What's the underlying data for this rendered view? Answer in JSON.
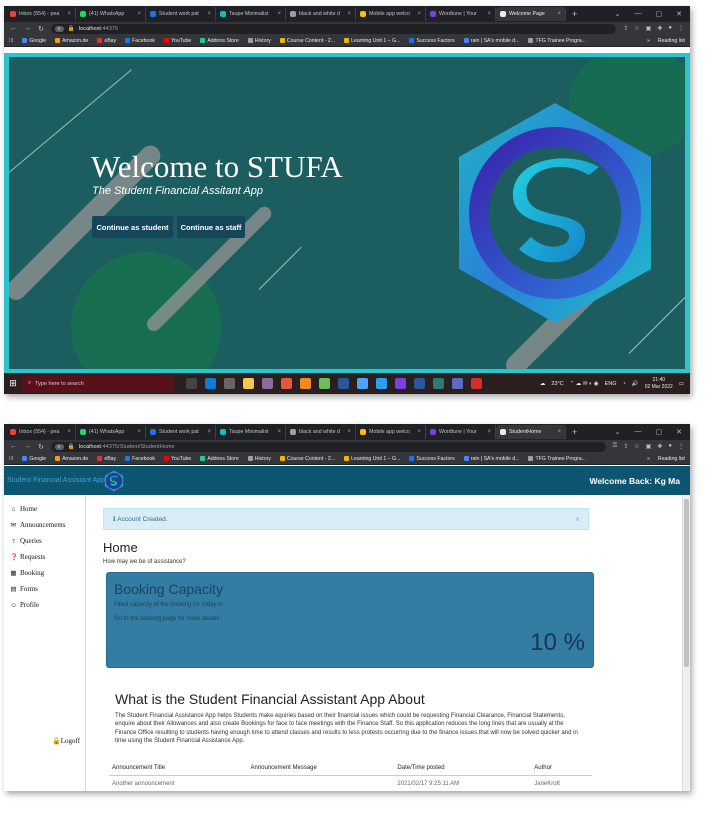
{
  "browser1": {
    "tabs": [
      {
        "label": "Inbox (554) - pea",
        "color": "#ea4335"
      },
      {
        "label": "(41) WhatsApp",
        "color": "#25d366"
      },
      {
        "label": "Student work pat",
        "color": "#1a73e8"
      },
      {
        "label": "Taupe Minimalist",
        "color": "#00c4cc"
      },
      {
        "label": "black and white d",
        "color": "#9aa0a6"
      },
      {
        "label": "Mobile app welco",
        "color": "#fbbc04"
      },
      {
        "label": "Wordtune | Your",
        "color": "#7b3fe4"
      },
      {
        "label": "Welcome Page",
        "color": "#e8eaed"
      }
    ],
    "active_tab": 7,
    "url_host": "localhost",
    "url_path": ":44375"
  },
  "browser2": {
    "tabs": [
      {
        "label": "Inbox (554) - pea",
        "color": "#ea4335"
      },
      {
        "label": "(41) WhatsApp",
        "color": "#25d366"
      },
      {
        "label": "Student work pat",
        "color": "#1a73e8"
      },
      {
        "label": "Taupe Minimalist",
        "color": "#00c4cc"
      },
      {
        "label": "black and white d",
        "color": "#9aa0a6"
      },
      {
        "label": "Mobile app welco",
        "color": "#fbbc04"
      },
      {
        "label": "Wordtune | Your",
        "color": "#7b3fe4"
      },
      {
        "label": "StudentHome",
        "color": "#e8eaed"
      }
    ],
    "active_tab": 7,
    "url_host": "localhost",
    "url_path": ":44375/Student/StudentHome"
  },
  "bookmarks": [
    {
      "label": "Google",
      "color": "#4285f4"
    },
    {
      "label": "Amazon.de",
      "color": "#ff9900"
    },
    {
      "label": "eBay",
      "color": "#e53238"
    },
    {
      "label": "Facebook",
      "color": "#1877f2"
    },
    {
      "label": "YouTube",
      "color": "#ff0000"
    },
    {
      "label": "Addons Store",
      "color": "#20c997"
    },
    {
      "label": "History",
      "color": "#9aa0a6"
    },
    {
      "label": "Course Content - 2...",
      "color": "#f4b400"
    },
    {
      "label": "Learning Unit 1 – G...",
      "color": "#f4b400"
    },
    {
      "label": "Success Factors",
      "color": "#1a73e8"
    },
    {
      "label": "rain | SA's mobile d...",
      "color": "#4285f4"
    },
    {
      "label": "TFG Trainee Progra...",
      "color": "#9aa0a6"
    }
  ],
  "reading_list": "Reading list",
  "welcome": {
    "title": "Welcome to STUFA",
    "subtitle": "The Student Financial Assitant App",
    "btn_student": "Continue as student",
    "btn_staff": "Continue as staff"
  },
  "taskbar": {
    "search_placeholder": "Type here to search",
    "weather": "23°C",
    "lang": "ENG",
    "time": "21:40",
    "date": "02 Mar 2022"
  },
  "app": {
    "brand": "Student Financial Assistant App",
    "welcome_back": "Welcome Back: Kg Ma",
    "nav": [
      {
        "label": "Home",
        "icon": "home-icon",
        "glyph": "⌂"
      },
      {
        "label": "Announcements",
        "icon": "bullhorn-icon",
        "glyph": "✉"
      },
      {
        "label": "Queries",
        "icon": "question-icon",
        "glyph": "?"
      },
      {
        "label": "Requests",
        "icon": "question-circle-icon",
        "glyph": "❓"
      },
      {
        "label": "Booking",
        "icon": "calendar-icon",
        "glyph": "▦"
      },
      {
        "label": "Forms",
        "icon": "file-icon",
        "glyph": "▤"
      },
      {
        "label": "Profile",
        "icon": "user-icon",
        "glyph": "☺"
      }
    ],
    "logoff": "Logoff",
    "alert": "Account Created.",
    "alert_close": "×",
    "home_title": "Home",
    "home_sub": "How may we be of assistance?",
    "card": {
      "title": "Booking Capacity",
      "line1": "Filled capacity of the booking for today is:",
      "line2": "Go to the booking page for more details",
      "value": "10 %"
    },
    "about_title": "What is the Student Financial Assistant App About",
    "about_text": "The Student Financial Assistance App helps Students make equiries based on their financial issues which could be requesting Financial Clearance, Financial Statements, enquire about their Allowances and also create Bookings for face to face meetings with the Finance Staff. So this application reduces the long lines that are usually at the Finance Office resulting to students having enough time to attend classes and results to less protests occurring due to the finance issues that will now be solved quicker and in time using the Student Financial Assistance App.",
    "table": {
      "headers": [
        "Announcement Title",
        "Announcement Message",
        "Date/Time posted",
        "Author"
      ],
      "rows": [
        [
          "Another announcement",
          "",
          "2021/02/17 9:25:11 AM",
          "JaneKrott"
        ]
      ]
    }
  },
  "colors": {
    "teal_bg": "#1c5e60",
    "cyan_border": "#2cc5cf",
    "app_header": "#0e5570",
    "card_bg": "#337ca3"
  }
}
